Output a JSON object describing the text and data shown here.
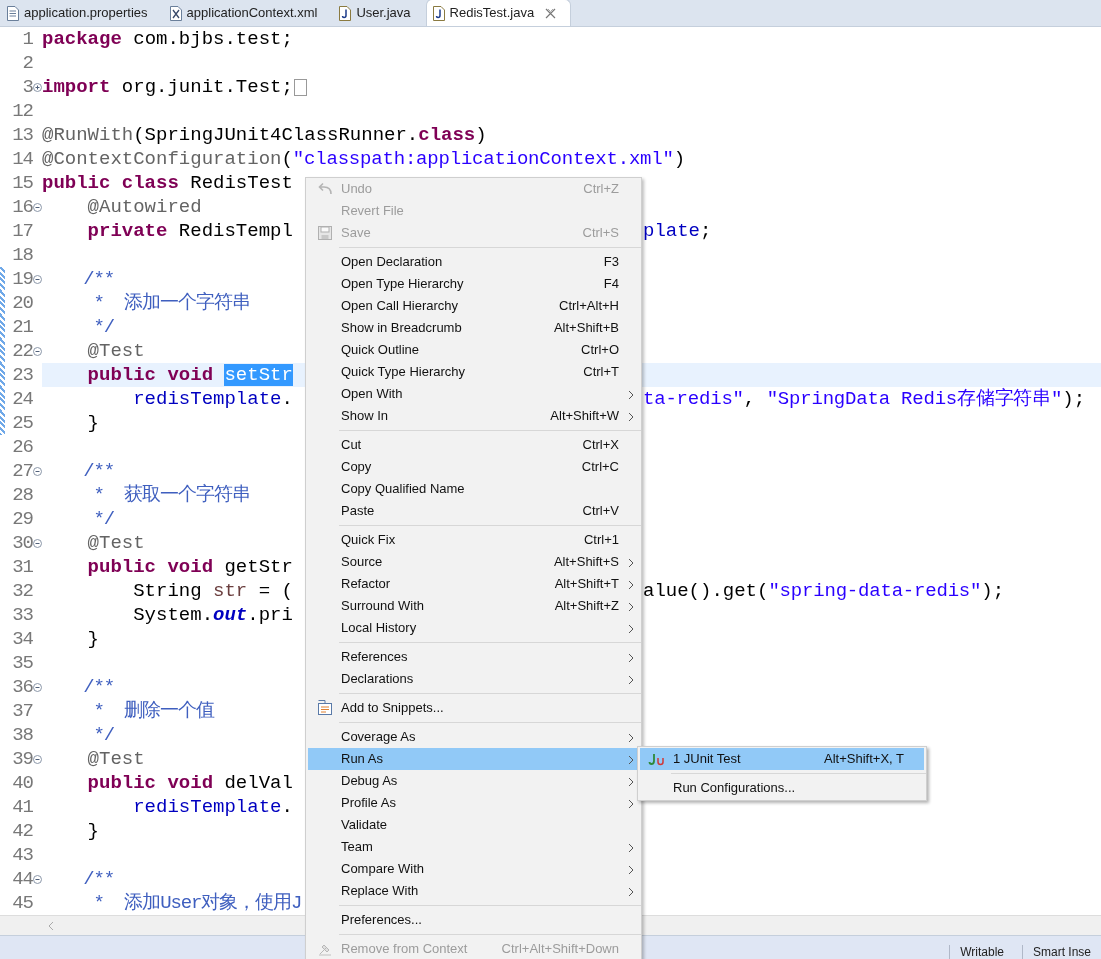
{
  "tabs": [
    {
      "label": "application.properties",
      "kind": "properties",
      "selected": false
    },
    {
      "label": "applicationContext.xml",
      "kind": "xml",
      "selected": false
    },
    {
      "label": "User.java",
      "kind": "java",
      "selected": false
    },
    {
      "label": "RedisTest.java",
      "kind": "java",
      "selected": true,
      "closable": true
    }
  ],
  "editor": {
    "lines": [
      {
        "num": "1",
        "current": false,
        "changed": false,
        "left": [
          {
            "kind": "keyword",
            "text": "package"
          },
          {
            "kind": "plain",
            "text": " com.bjbs.test;"
          }
        ]
      },
      {
        "num": "2",
        "current": false,
        "changed": false
      },
      {
        "num": "3",
        "fold_marker": true,
        "collapsed": true,
        "folded_box": true,
        "current": false,
        "changed": false,
        "left": [
          {
            "kind": "keyword",
            "text": "import"
          },
          {
            "kind": "plain",
            "text": " org.junit.Test;"
          }
        ]
      },
      {
        "num": "12",
        "current": false,
        "changed": false
      },
      {
        "num": "13",
        "current": false,
        "changed": false,
        "left": [
          {
            "kind": "annotation",
            "text": "@RunWith"
          },
          {
            "kind": "plain",
            "text": "(SpringJUnit4ClassRunner."
          },
          {
            "kind": "keyword",
            "text": "class"
          },
          {
            "kind": "plain",
            "text": ")"
          }
        ]
      },
      {
        "num": "14",
        "current": false,
        "changed": false,
        "left": [
          {
            "kind": "annotation",
            "text": "@ContextConfiguration"
          },
          {
            "kind": "plain",
            "text": "("
          },
          {
            "kind": "string",
            "text": "\"classpath:applicationContext.xml\""
          },
          {
            "kind": "plain",
            "text": ")"
          }
        ]
      },
      {
        "num": "15",
        "current": false,
        "changed": false,
        "left": [
          {
            "kind": "keyword",
            "text": "public class"
          },
          {
            "kind": "plain",
            "text": " RedisTest"
          }
        ]
      },
      {
        "num": "16",
        "fold_marker": true,
        "collapsed": false,
        "current": false,
        "changed": false,
        "left": [
          {
            "kind": "annotation",
            "text": "    @Autowired"
          }
        ]
      },
      {
        "num": "17",
        "current": false,
        "changed": false,
        "left": [
          {
            "kind": "keyword",
            "text": "    private"
          },
          {
            "kind": "plain",
            "text": " RedisTempl"
          }
        ],
        "right": [
          {
            "kind": "field",
            "text": "plate"
          },
          {
            "kind": "plain",
            "text": ";"
          }
        ]
      },
      {
        "num": "18",
        "current": false,
        "changed": false
      },
      {
        "num": "19",
        "fold_marker": true,
        "collapsed": false,
        "current": false,
        "changed": true,
        "left": [
          {
            "kind": "comment",
            "text": "    /**"
          }
        ]
      },
      {
        "num": "20",
        "current": false,
        "changed": true,
        "left": [
          {
            "kind": "comment",
            "text": "     *  添加一个字符串"
          }
        ]
      },
      {
        "num": "21",
        "current": false,
        "changed": true,
        "left": [
          {
            "kind": "comment",
            "text": "     */"
          }
        ]
      },
      {
        "num": "22",
        "fold_marker": true,
        "collapsed": false,
        "current": false,
        "changed": true,
        "left": [
          {
            "kind": "annotation",
            "text": "    @Test"
          }
        ]
      },
      {
        "num": "23",
        "current": true,
        "changed": true,
        "left": [
          {
            "kind": "keyword",
            "text": "    public void "
          },
          {
            "kind": "selection",
            "text": "setStr"
          }
        ]
      },
      {
        "num": "24",
        "current": false,
        "changed": true,
        "left": [
          {
            "kind": "field",
            "text": "        redisTemplate"
          },
          {
            "kind": "plain",
            "text": "."
          }
        ],
        "right": [
          {
            "kind": "string",
            "text": "ta-redis\""
          },
          {
            "kind": "plain",
            "text": ", "
          },
          {
            "kind": "string",
            "text": "\"SpringData Redis存储字符串\""
          },
          {
            "kind": "plain",
            "text": ");"
          }
        ]
      },
      {
        "num": "25",
        "current": false,
        "changed": true,
        "left": [
          {
            "kind": "plain",
            "text": "    }"
          }
        ]
      },
      {
        "num": "26",
        "current": false,
        "changed": false
      },
      {
        "num": "27",
        "fold_marker": true,
        "collapsed": false,
        "current": false,
        "changed": false,
        "left": [
          {
            "kind": "comment",
            "text": "    /**"
          }
        ]
      },
      {
        "num": "28",
        "current": false,
        "changed": false,
        "left": [
          {
            "kind": "comment",
            "text": "     *  获取一个字符串"
          }
        ]
      },
      {
        "num": "29",
        "current": false,
        "changed": false,
        "left": [
          {
            "kind": "comment",
            "text": "     */"
          }
        ]
      },
      {
        "num": "30",
        "fold_marker": true,
        "collapsed": false,
        "current": false,
        "changed": false,
        "left": [
          {
            "kind": "annotation",
            "text": "    @Test"
          }
        ]
      },
      {
        "num": "31",
        "current": false,
        "changed": false,
        "left": [
          {
            "kind": "keyword",
            "text": "    public void"
          },
          {
            "kind": "plain",
            "text": " getStr"
          }
        ]
      },
      {
        "num": "32",
        "current": false,
        "changed": false,
        "left": [
          {
            "kind": "plain",
            "text": "        String "
          },
          {
            "kind": "local_var",
            "text": "str"
          },
          {
            "kind": "plain",
            "text": " = ("
          }
        ],
        "right": [
          {
            "kind": "plain",
            "text": "alue().get("
          },
          {
            "kind": "string",
            "text": "\"spring-data-redis\""
          },
          {
            "kind": "plain",
            "text": ");"
          }
        ]
      },
      {
        "num": "33",
        "current": false,
        "changed": false,
        "left": [
          {
            "kind": "plain",
            "text": "        System."
          },
          {
            "kind": "static_field",
            "text": "out"
          },
          {
            "kind": "plain",
            "text": ".pri"
          }
        ]
      },
      {
        "num": "34",
        "current": false,
        "changed": false,
        "left": [
          {
            "kind": "plain",
            "text": "    }"
          }
        ]
      },
      {
        "num": "35",
        "current": false,
        "changed": false
      },
      {
        "num": "36",
        "fold_marker": true,
        "collapsed": false,
        "current": false,
        "changed": false,
        "left": [
          {
            "kind": "comment",
            "text": "    /**"
          }
        ]
      },
      {
        "num": "37",
        "current": false,
        "changed": false,
        "left": [
          {
            "kind": "comment",
            "text": "     *  删除一个值"
          }
        ]
      },
      {
        "num": "38",
        "current": false,
        "changed": false,
        "left": [
          {
            "kind": "comment",
            "text": "     */"
          }
        ]
      },
      {
        "num": "39",
        "fold_marker": true,
        "collapsed": false,
        "current": false,
        "changed": false,
        "left": [
          {
            "kind": "annotation",
            "text": "    @Test"
          }
        ]
      },
      {
        "num": "40",
        "current": false,
        "changed": false,
        "left": [
          {
            "kind": "keyword",
            "text": "    public void"
          },
          {
            "kind": "plain",
            "text": " delVal"
          }
        ]
      },
      {
        "num": "41",
        "current": false,
        "changed": false,
        "left": [
          {
            "kind": "field",
            "text": "        redisTemplate"
          },
          {
            "kind": "plain",
            "text": "."
          }
        ]
      },
      {
        "num": "42",
        "current": false,
        "changed": false,
        "left": [
          {
            "kind": "plain",
            "text": "    }"
          }
        ]
      },
      {
        "num": "43",
        "current": false,
        "changed": false
      },
      {
        "num": "44",
        "fold_marker": true,
        "collapsed": false,
        "current": false,
        "changed": false,
        "left": [
          {
            "kind": "comment",
            "text": "    /**"
          }
        ]
      },
      {
        "num": "45",
        "current": false,
        "changed": false,
        "left": [
          {
            "kind": "comment",
            "text": "     *  添加User对象，使用J"
          }
        ]
      }
    ]
  },
  "context_menu": {
    "items": [
      {
        "kind": "item",
        "label": "Undo",
        "shortcut": "Ctrl+Z",
        "disabled": true,
        "submenu": false,
        "selected": false
      },
      {
        "kind": "item",
        "label": "Revert File",
        "disabled": true,
        "submenu": false,
        "selected": false
      },
      {
        "kind": "item",
        "label": "Save",
        "shortcut": "Ctrl+S",
        "disabled": true,
        "submenu": false,
        "selected": false
      },
      {
        "kind": "separator"
      },
      {
        "kind": "item",
        "label": "Open Declaration",
        "shortcut": "F3",
        "disabled": false,
        "submenu": false,
        "selected": false
      },
      {
        "kind": "item",
        "label": "Open Type Hierarchy",
        "shortcut": "F4",
        "disabled": false,
        "submenu": false,
        "selected": false
      },
      {
        "kind": "item",
        "label": "Open Call Hierarchy",
        "shortcut": "Ctrl+Alt+H",
        "disabled": false,
        "submenu": false,
        "selected": false
      },
      {
        "kind": "item",
        "label": "Show in Breadcrumb",
        "shortcut": "Alt+Shift+B",
        "disabled": false,
        "submenu": false,
        "selected": false
      },
      {
        "kind": "item",
        "label": "Quick Outline",
        "shortcut": "Ctrl+O",
        "disabled": false,
        "submenu": false,
        "selected": false
      },
      {
        "kind": "item",
        "label": "Quick Type Hierarchy",
        "shortcut": "Ctrl+T",
        "disabled": false,
        "submenu": false,
        "selected": false
      },
      {
        "kind": "item",
        "label": "Open With",
        "disabled": false,
        "submenu": true,
        "selected": false
      },
      {
        "kind": "item",
        "label": "Show In",
        "shortcut": "Alt+Shift+W",
        "disabled": false,
        "submenu": true,
        "selected": false
      },
      {
        "kind": "separator"
      },
      {
        "kind": "item",
        "label": "Cut",
        "shortcut": "Ctrl+X",
        "disabled": false,
        "submenu": false,
        "selected": false
      },
      {
        "kind": "item",
        "label": "Copy",
        "shortcut": "Ctrl+C",
        "disabled": false,
        "submenu": false,
        "selected": false
      },
      {
        "kind": "item",
        "label": "Copy Qualified Name",
        "disabled": false,
        "submenu": false,
        "selected": false
      },
      {
        "kind": "item",
        "label": "Paste",
        "shortcut": "Ctrl+V",
        "disabled": false,
        "submenu": false,
        "selected": false
      },
      {
        "kind": "separator"
      },
      {
        "kind": "item",
        "label": "Quick Fix",
        "shortcut": "Ctrl+1",
        "disabled": false,
        "submenu": false,
        "selected": false
      },
      {
        "kind": "item",
        "label": "Source",
        "shortcut": "Alt+Shift+S",
        "disabled": false,
        "submenu": true,
        "selected": false
      },
      {
        "kind": "item",
        "label": "Refactor",
        "shortcut": "Alt+Shift+T",
        "disabled": false,
        "submenu": true,
        "selected": false
      },
      {
        "kind": "item",
        "label": "Surround With",
        "shortcut": "Alt+Shift+Z",
        "disabled": false,
        "submenu": true,
        "selected": false
      },
      {
        "kind": "item",
        "label": "Local History",
        "disabled": false,
        "submenu": true,
        "selected": false
      },
      {
        "kind": "separator"
      },
      {
        "kind": "item",
        "label": "References",
        "disabled": false,
        "submenu": true,
        "selected": false
      },
      {
        "kind": "item",
        "label": "Declarations",
        "disabled": false,
        "submenu": true,
        "selected": false
      },
      {
        "kind": "separator"
      },
      {
        "kind": "item",
        "label": "Add to Snippets...",
        "disabled": false,
        "submenu": false,
        "selected": false
      },
      {
        "kind": "separator"
      },
      {
        "kind": "item",
        "label": "Coverage As",
        "disabled": false,
        "submenu": true,
        "selected": false
      },
      {
        "kind": "item",
        "label": "Run As",
        "disabled": false,
        "submenu": true,
        "selected": true
      },
      {
        "kind": "item",
        "label": "Debug As",
        "disabled": false,
        "submenu": true,
        "selected": false
      },
      {
        "kind": "item",
        "label": "Profile As",
        "disabled": false,
        "submenu": true,
        "selected": false
      },
      {
        "kind": "item",
        "label": "Validate",
        "disabled": false,
        "submenu": false,
        "selected": false
      },
      {
        "kind": "item",
        "label": "Team",
        "disabled": false,
        "submenu": true,
        "selected": false
      },
      {
        "kind": "item",
        "label": "Compare With",
        "disabled": false,
        "submenu": true,
        "selected": false
      },
      {
        "kind": "item",
        "label": "Replace With",
        "disabled": false,
        "submenu": true,
        "selected": false
      },
      {
        "kind": "separator"
      },
      {
        "kind": "item",
        "label": "Preferences...",
        "disabled": false,
        "submenu": false,
        "selected": false
      },
      {
        "kind": "separator"
      },
      {
        "kind": "item",
        "label": "Remove from Context",
        "shortcut": "Ctrl+Alt+Shift+Down",
        "disabled": true,
        "submenu": false,
        "selected": false
      }
    ]
  },
  "submenu": {
    "items": [
      {
        "kind": "item",
        "label": "1 JUnit Test",
        "shortcut": "Alt+Shift+X, T",
        "disabled": false,
        "submenu": false,
        "selected": true
      },
      {
        "kind": "separator"
      },
      {
        "kind": "item",
        "label": "Run Configurations...",
        "disabled": false,
        "submenu": false,
        "selected": false
      }
    ]
  },
  "status_bar": {
    "fields": [
      "Writable",
      "Smart Inse"
    ]
  }
}
